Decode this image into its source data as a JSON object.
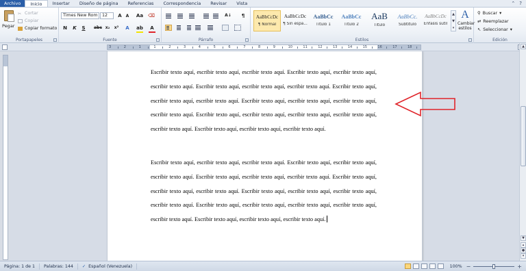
{
  "tabs": {
    "file": "Archivo",
    "items": [
      "Inicio",
      "Insertar",
      "Diseño de página",
      "Referencias",
      "Correspondencia",
      "Revisar",
      "Vista"
    ],
    "active_index": 0
  },
  "clipboard": {
    "paste": "Pegar",
    "cut": "Cortar",
    "copy": "Copiar",
    "format_painter": "Copiar formato",
    "group_label": "Portapapeles"
  },
  "font": {
    "name": "Times New Rom",
    "size": "12",
    "group_label": "Fuente"
  },
  "paragraph": {
    "group_label": "Párrafo"
  },
  "styles": {
    "items": [
      {
        "sample": "AaBbCcDc",
        "name": "¶ Normal",
        "selected": true
      },
      {
        "sample": "AaBbCcDc",
        "name": "¶ Sin espa...",
        "selected": false
      },
      {
        "sample": "AaBbCc",
        "name": "Título 1",
        "selected": false
      },
      {
        "sample": "AaBbCc",
        "name": "Título 2",
        "selected": false
      },
      {
        "sample": "AaB",
        "name": "Título",
        "selected": false
      },
      {
        "sample": "AaBbCc.",
        "name": "Subtítulo",
        "selected": false
      },
      {
        "sample": "AaBbCcDc",
        "name": "Énfasis sutil",
        "selected": false
      }
    ],
    "change_styles": "Cambiar estilos",
    "group_label": "Estilos"
  },
  "editing": {
    "find": "Buscar",
    "replace": "Reemplazar",
    "select": "Seleccionar",
    "group_label": "Edición"
  },
  "ruler": {
    "numbers": [
      "3",
      "2",
      "1",
      "1",
      "2",
      "3",
      "4",
      "5",
      "6",
      "7",
      "8",
      "9",
      "10",
      "11",
      "12",
      "13",
      "14",
      "15",
      "16",
      "17",
      "18"
    ]
  },
  "document": {
    "paragraph1": "Escribir texto aquí, escribir texto aquí, escribir texto aquí. Escribir texto aquí, escribir texto aquí, escribir texto aquí. Escribir texto aquí, escribir texto aquí, escribir texto aquí. Escribir texto aquí, escribir texto aquí, escribir texto aquí. Escribir texto aquí, escribir texto aquí, escribir texto aquí, escribir texto aquí. Escribir texto aquí, escribir texto aquí, escribir texto aquí, escribir texto aquí, escribir texto aquí. Escribir texto aquí, escribir texto aquí, escribir texto aquí.",
    "paragraph2": "Escribir texto aquí, escribir texto aquí, escribir texto aquí. Escribir texto aquí, escribir texto aquí, escribir texto aquí. Escribir texto aquí, escribir texto aquí, escribir texto aquí. Escribir texto aquí, escribir texto aquí, escribir texto aquí. Escribir texto aquí, escribir texto aquí, escribir texto aquí, escribir texto aquí. Escribir texto aquí, escribir texto aquí, escribir texto aquí, escribir texto aquí, escribir texto aquí. Escribir texto aquí, escribir texto aquí, escribir texto aquí."
  },
  "status": {
    "page": "Página: 1 de 1",
    "words": "Palabras: 144",
    "language": "Español (Venezuela)",
    "zoom": "100%"
  },
  "colors": {
    "accent": "#2a5ea8",
    "annotation_arrow": "#e0242a",
    "selected_style": "#fde9ad"
  }
}
